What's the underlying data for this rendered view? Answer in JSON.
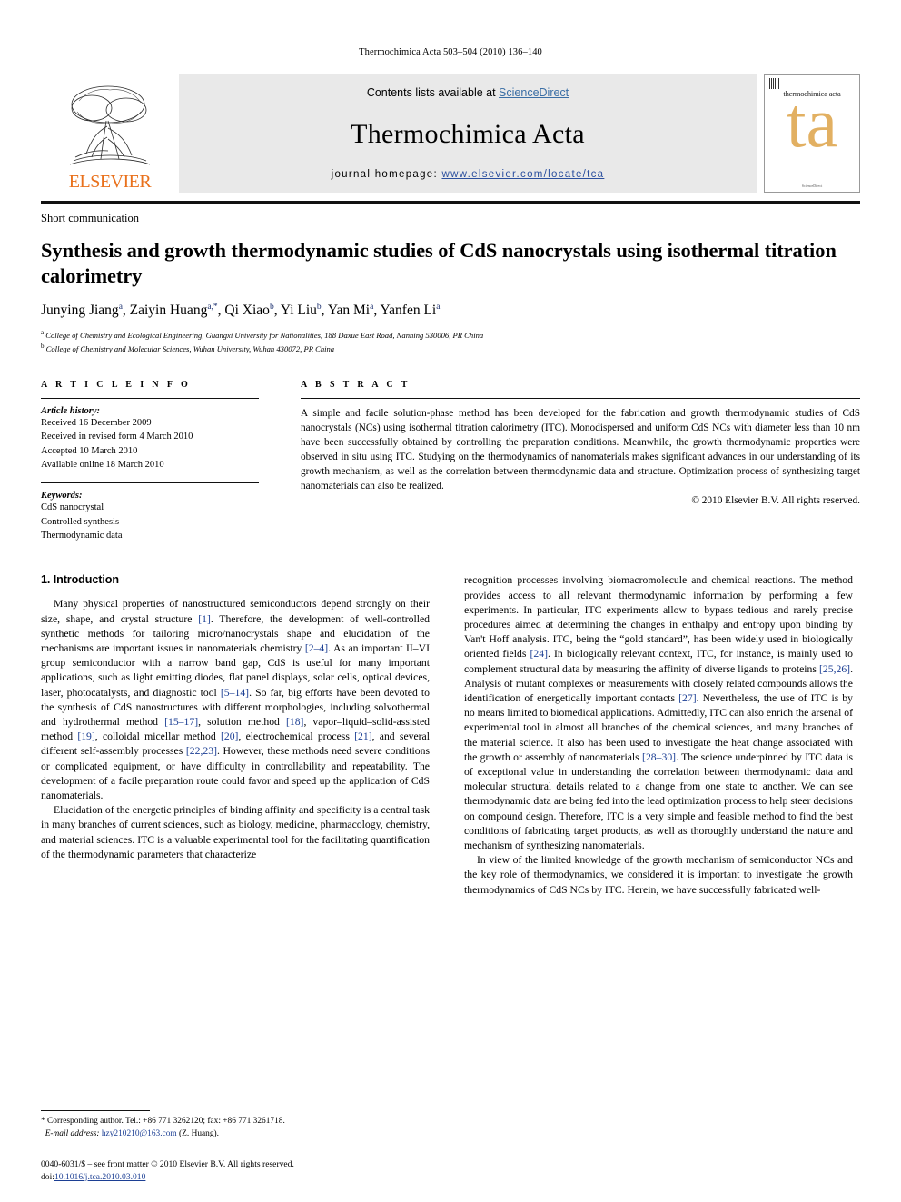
{
  "running_head": "Thermochimica Acta 503–504 (2010) 136–140",
  "masthead": {
    "publisher_name": "ELSEVIER",
    "contents_prefix": "Contents lists available at ",
    "contents_link": "ScienceDirect",
    "journal_title": "Thermochimica Acta",
    "homepage_prefix": "journal homepage: ",
    "homepage_url": "www.elsevier.com/locate/tca",
    "cover_title": "thermochimica acta",
    "cover_mark": "ta",
    "link_color": "#3a6ea5",
    "url_color": "#2b4f9e"
  },
  "article": {
    "type": "Short communication",
    "title": "Synthesis and growth thermodynamic studies of CdS nanocrystals using isothermal titration calorimetry",
    "authors": [
      {
        "name": "Junying Jiang",
        "marks": "a"
      },
      {
        "name": "Zaiyin Huang",
        "marks": "a,*"
      },
      {
        "name": "Qi Xiao",
        "marks": "b"
      },
      {
        "name": "Yi Liu",
        "marks": "b"
      },
      {
        "name": "Yan Mi",
        "marks": "a"
      },
      {
        "name": "Yanfen Li",
        "marks": "a"
      }
    ],
    "affiliations": [
      {
        "mark": "a",
        "text": "College of Chemistry and Ecological Engineering, Guangxi University for Nationalities, 188 Daxue East Road, Nanning 530006, PR China"
      },
      {
        "mark": "b",
        "text": "College of Chemistry and Molecular Sciences, Wuhan University, Wuhan 430072, PR China"
      }
    ]
  },
  "article_info": {
    "heading": "A R T I C L E  I N F O",
    "history_label": "Article history:",
    "history": [
      "Received 16 December 2009",
      "Received in revised form 4 March 2010",
      "Accepted 10 March 2010",
      "Available online 18 March 2010"
    ],
    "keywords_label": "Keywords:",
    "keywords": [
      "CdS nanocrystal",
      "Controlled synthesis",
      "Thermodynamic data"
    ]
  },
  "abstract": {
    "heading": "A B S T R A C T",
    "text": "A simple and facile solution-phase method has been developed for the fabrication and growth thermodynamic studies of CdS nanocrystals (NCs) using isothermal titration calorimetry (ITC). Monodispersed and uniform CdS NCs with diameter less than 10 nm have been successfully obtained by controlling the preparation conditions. Meanwhile, the growth thermodynamic properties were observed in situ using ITC. Studying on the thermodynamics of nanomaterials makes significant advances in our understanding of its growth mechanism, as well as the correlation between thermodynamic data and structure. Optimization process of synthesizing target nanomaterials can also be realized.",
    "copyright": "© 2010 Elsevier B.V. All rights reserved."
  },
  "section": {
    "number_title": "1. Introduction"
  },
  "paragraphs": {
    "left_1": "Many physical properties of nanostructured semiconductors depend strongly on their size, shape, and crystal structure [1]. Therefore, the development of well-controlled synthetic methods for tailoring micro/nanocrystals shape and elucidation of the mechanisms are important issues in nanomaterials chemistry [2–4]. As an important II–VI group semiconductor with a narrow band gap, CdS is useful for many important applications, such as light emitting diodes, flat panel displays, solar cells, optical devices, laser, photocatalysts, and diagnostic tool [5–14]. So far, big efforts have been devoted to the synthesis of CdS nanostructures with different morphologies, including solvothermal and hydrothermal method [15–17], solution method [18], vapor–liquid–solid-assisted method [19], colloidal micellar method [20], electrochemical process [21], and several different self-assembly processes [22,23]. However, these methods need severe conditions or complicated equipment, or have difficulty in controllability and repeatability. The development of a facile preparation route could favor and speed up the application of CdS nanomaterials.",
    "left_2": "Elucidation of the energetic principles of binding affinity and specificity is a central task in many branches of current sciences, such as biology, medicine, pharmacology, chemistry, and material sciences. ITC is a valuable experimental tool for the facilitating quantification of the thermodynamic parameters that characterize",
    "right_1": "recognition processes involving biomacromolecule and chemical reactions. The method provides access to all relevant thermodynamic information by performing a few experiments. In particular, ITC experiments allow to bypass tedious and rarely precise procedures aimed at determining the changes in enthalpy and entropy upon binding by Van't Hoff analysis. ITC, being the “gold standard”, has been widely used in biologically oriented fields [24]. In biologically relevant context, ITC, for instance, is mainly used to complement structural data by measuring the affinity of diverse ligands to proteins [25,26]. Analysis of mutant complexes or measurements with closely related compounds allows the identification of energetically important contacts [27]. Nevertheless, the use of ITC is by no means limited to biomedical applications. Admittedly, ITC can also enrich the arsenal of experimental tool in almost all branches of the chemical sciences, and many branches of the material science. It also has been used to investigate the heat change associated with the growth or assembly of nanomaterials [28–30]. The science underpinned by ITC data is of exceptional value in understanding the correlation between thermodynamic data and molecular structural details related to a change from one state to another. We can see thermodynamic data are being fed into the lead optimization process to help steer decisions on compound design. Therefore, ITC is a very simple and feasible method to find the best conditions of fabricating target products, as well as thoroughly understand the nature and mechanism of synthesizing nanomaterials.",
    "right_2": "In view of the limited knowledge of the growth mechanism of semiconductor NCs and the key role of thermodynamics, we considered it is important to investigate the growth thermodynamics of CdS NCs by ITC. Herein, we have successfully fabricated well-"
  },
  "footnote": {
    "corresponding": "* Corresponding author. Tel.: +86 771 3262120; fax: +86 771 3261718.",
    "email_label": "E-mail address:",
    "email": "hzy210210@163.com",
    "email_suffix": "(Z. Huang)."
  },
  "issn_block": {
    "line1": "0040-6031/$ – see front matter © 2010 Elsevier B.V. All rights reserved.",
    "doi_label": "doi:",
    "doi": "10.1016/j.tca.2010.03.010"
  }
}
